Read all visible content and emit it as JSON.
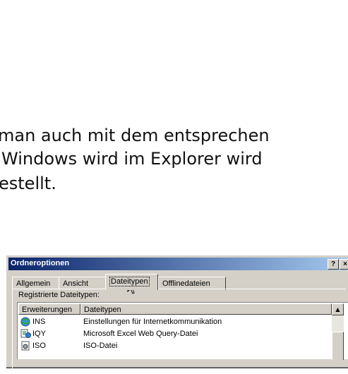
{
  "document": {
    "line1": "man auch mit dem entsprechen",
    "line2": "Windows wird im Explorer wird",
    "line3": "estellt."
  },
  "dialog": {
    "title": "Ordneroptionen",
    "help_label": "?",
    "close_label": "×",
    "tabs": [
      {
        "label": "Allgemein"
      },
      {
        "label": "Ansicht"
      },
      {
        "label": "Dateitypen"
      },
      {
        "label": "Offlinedateien"
      }
    ],
    "active_tab": "Dateitypen",
    "registered_label": "Registrierte Dateitypen:",
    "columns": [
      "Erweiterungen",
      "Dateitypen"
    ],
    "rows": [
      {
        "ext": "INS",
        "type": "Einstellungen für Internetkommunikation",
        "icon": "globe-settings-icon"
      },
      {
        "ext": "IQY",
        "type": "Microsoft Excel Web Query-Datei",
        "icon": "excel-web-query-icon"
      },
      {
        "ext": "ISO",
        "type": "ISO-Datei",
        "icon": "disc-image-file-icon"
      }
    ],
    "scroll_up_glyph": "▲"
  },
  "colors": {
    "title_gradient_start": "#0a246a",
    "title_gradient_end": "#a6caf0",
    "face": "#d4d0c8"
  }
}
